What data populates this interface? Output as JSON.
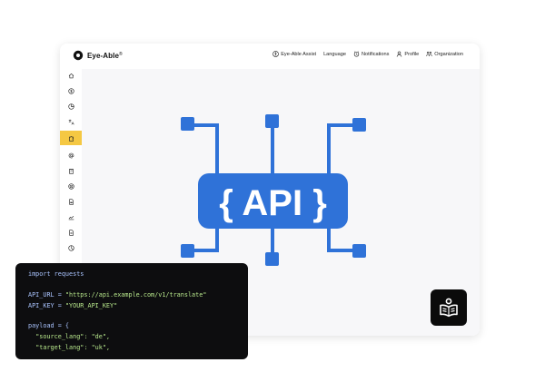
{
  "app": {
    "brand": "Eye-Able",
    "brand_suffix": "®"
  },
  "nav": [
    {
      "label": "Eye-Able Assist",
      "icon": "accessibility-icon"
    },
    {
      "label": "Language",
      "icon": ""
    },
    {
      "label": "Notifications",
      "icon": "alarm-clock-icon"
    },
    {
      "label": "Profile",
      "icon": "user-icon"
    },
    {
      "label": "Organization",
      "icon": "people-icon"
    }
  ],
  "sidebar": {
    "items": [
      {
        "icon": "home-icon",
        "active": false
      },
      {
        "icon": "dollar-icon",
        "active": false
      },
      {
        "icon": "pie-chart-icon",
        "active": false
      },
      {
        "icon": "translate-icon",
        "active": false
      },
      {
        "icon": "puzzle-icon",
        "active": true
      },
      {
        "icon": "at-sign-icon",
        "active": false
      },
      {
        "icon": "clipboard-icon",
        "active": false
      },
      {
        "icon": "target-icon",
        "active": false
      },
      {
        "icon": "pdf-icon",
        "active": false
      },
      {
        "icon": "trend-icon",
        "active": false
      },
      {
        "icon": "document-icon",
        "active": false
      },
      {
        "icon": "chart-icon",
        "active": false
      }
    ],
    "active_color": "#f5c843"
  },
  "diagram": {
    "label": "{ API }",
    "color": "#2f72d8"
  },
  "code": {
    "lines": [
      {
        "text": "import requests",
        "kind": "keyword"
      },
      {
        "text": "API_URL = ",
        "kind": "keyword",
        "value": "\"https://api.example.com/v1/translate\""
      },
      {
        "text": "API_KEY = ",
        "kind": "keyword",
        "value": "\"YOUR_API_KEY\""
      },
      {
        "text": "payload = {",
        "kind": "keyword"
      },
      {
        "text": "  ",
        "kind": "keyword",
        "value": "\"source_lang\": \"de\","
      },
      {
        "text": "  ",
        "kind": "keyword",
        "value": "\"target_lang\": \"uk\","
      }
    ]
  },
  "reader_button": {
    "icon": "reader-book-icon"
  }
}
